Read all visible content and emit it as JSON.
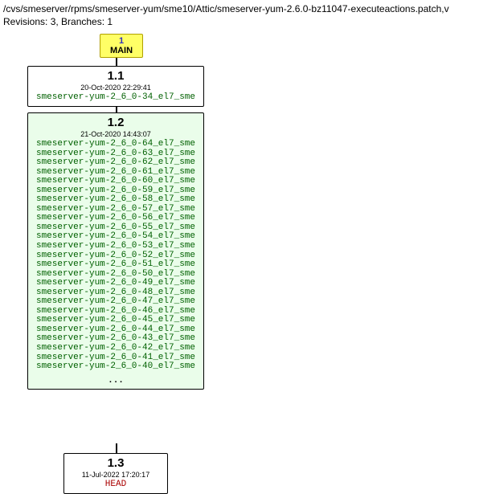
{
  "header": {
    "path": "/cvs/smeserver/rpms/smeserver-yum/sme10/Attic/smeserver-yum-2.6.0-bz11047-executeactions.patch,v",
    "stats": "Revisions: 3, Branches: 1"
  },
  "main": {
    "number": "1",
    "label": "MAIN"
  },
  "rev1": {
    "version": "1.1",
    "date": "20-Oct-2020 22:29:41",
    "labels": [
      "smeserver-yum-2_6_0-34_el7_sme"
    ]
  },
  "rev2": {
    "version": "1.2",
    "date": "21-Oct-2020 14:43:07",
    "labels": [
      "smeserver-yum-2_6_0-64_el7_sme",
      "smeserver-yum-2_6_0-63_el7_sme",
      "smeserver-yum-2_6_0-62_el7_sme",
      "smeserver-yum-2_6_0-61_el7_sme",
      "smeserver-yum-2_6_0-60_el7_sme",
      "smeserver-yum-2_6_0-59_el7_sme",
      "smeserver-yum-2_6_0-58_el7_sme",
      "smeserver-yum-2_6_0-57_el7_sme",
      "smeserver-yum-2_6_0-56_el7_sme",
      "smeserver-yum-2_6_0-55_el7_sme",
      "smeserver-yum-2_6_0-54_el7_sme",
      "smeserver-yum-2_6_0-53_el7_sme",
      "smeserver-yum-2_6_0-52_el7_sme",
      "smeserver-yum-2_6_0-51_el7_sme",
      "smeserver-yum-2_6_0-50_el7_sme",
      "smeserver-yum-2_6_0-49_el7_sme",
      "smeserver-yum-2_6_0-48_el7_sme",
      "smeserver-yum-2_6_0-47_el7_sme",
      "smeserver-yum-2_6_0-46_el7_sme",
      "smeserver-yum-2_6_0-45_el7_sme",
      "smeserver-yum-2_6_0-44_el7_sme",
      "smeserver-yum-2_6_0-43_el7_sme",
      "smeserver-yum-2_6_0-42_el7_sme",
      "smeserver-yum-2_6_0-41_el7_sme",
      "smeserver-yum-2_6_0-40_el7_sme"
    ],
    "overflow": "..."
  },
  "rev3": {
    "version": "1.3",
    "date": "11-Jul-2022 17:20:17",
    "labels": [
      "HEAD"
    ]
  }
}
